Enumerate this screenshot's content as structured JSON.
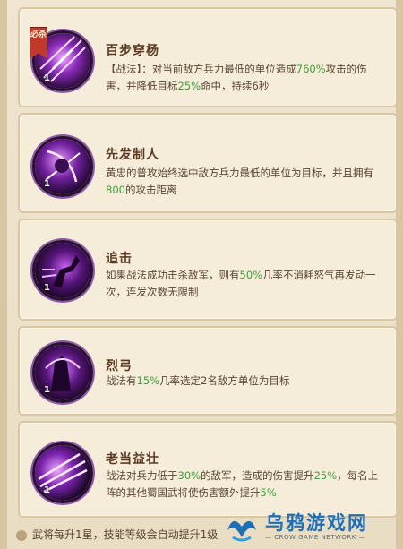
{
  "badge": "必杀",
  "skills": [
    {
      "name": "百步穿杨",
      "level": "1",
      "desc": [
        {
          "t": "【战法】：对当前敌方兵力最低的单位造成"
        },
        {
          "t": "760%",
          "hl": true
        },
        {
          "t": "攻击的伤害，并降低目标"
        },
        {
          "t": "25%",
          "hl": true
        },
        {
          "t": "命中，持续6秒"
        }
      ]
    },
    {
      "name": "先发制人",
      "level": "1",
      "desc": [
        {
          "t": "黄忠的普攻始终选中敌方兵力最低的单位为目标，并且拥有"
        },
        {
          "t": "800",
          "hl": true
        },
        {
          "t": "的攻击距离"
        }
      ]
    },
    {
      "name": "追击",
      "level": "1",
      "desc": [
        {
          "t": "如果战法成功击杀敌军，则有"
        },
        {
          "t": "50%",
          "hl": true
        },
        {
          "t": "几率不消耗怒气再发动一次，连发次数无限制"
        }
      ]
    },
    {
      "name": "烈弓",
      "level": "1",
      "desc": [
        {
          "t": "战法有"
        },
        {
          "t": "15%",
          "hl": true
        },
        {
          "t": "几率选定2名敌方单位为目标"
        }
      ]
    },
    {
      "name": "老当益壮",
      "level": "1",
      "desc": [
        {
          "t": "战法对兵力低于"
        },
        {
          "t": "30%",
          "hl": true
        },
        {
          "t": "的敌军，造成的伤害提升"
        },
        {
          "t": "25%",
          "hl": true
        },
        {
          "t": "，每名上阵的其他蜀国武将使伤害额外提升"
        },
        {
          "t": "5%",
          "hl": true
        }
      ]
    }
  ],
  "footer": "武将每升1星，技能等级会自动提升1级",
  "watermark": {
    "title": "乌鸦游戏网",
    "subtitle": "— CROW GAME NETWORK —"
  },
  "colors": {
    "highlight": "#3fa03a",
    "accent_purple": "#8c5aa8",
    "brand_blue": "#1f6fb5"
  }
}
